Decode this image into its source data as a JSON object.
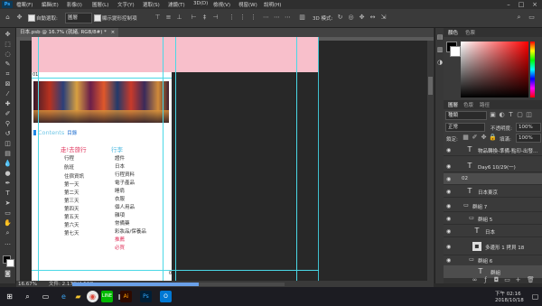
{
  "menubar": {
    "logo": "Ps",
    "items": [
      "檔案(F)",
      "編輯(E)",
      "影像(I)",
      "圖層(L)",
      "文字(Y)",
      "選取(S)",
      "濾鏡(T)",
      "3D(D)",
      "檢視(V)",
      "視窗(W)",
      "說明(H)"
    ]
  },
  "options": {
    "auto_select_label": "自動選取:",
    "auto_select_value": "圖層",
    "show_transform_label": "顯示變形控制項",
    "mode_3d_label": "3D 模式:"
  },
  "tab": {
    "title": "日本.psb @ 16.7% (就緒, RGB/8#) *",
    "close": "×"
  },
  "document": {
    "page_mark_top": "01",
    "page_mark_bottom": "02",
    "contents_title": "Contents",
    "contents_sub": "目錄",
    "left_heading": "走!去旅行",
    "left_items": [
      "行程",
      "航班",
      "住宿資訊",
      "第一天",
      "第二天",
      "第三天",
      "第四天",
      "第五天",
      "第六天",
      "第七天"
    ],
    "right_heading": "行李",
    "right_items": [
      "證件",
      "日本",
      "行程資料",
      "電子產品",
      "睡肩",
      "衣服",
      "個人用品",
      "雜項",
      "常備藥",
      "彩妝品/保養品"
    ],
    "right_highlight_1": "推薦",
    "right_highlight_2": "必買"
  },
  "status": {
    "zoom": "16.67%",
    "doc_info": "文件: 2.17G/4.53G"
  },
  "panels": {
    "color_tab": "顏色",
    "swatch_tab": "色票",
    "layers_tab": "圖層",
    "channels_tab": "色版",
    "paths_tab": "路徑",
    "filter_kind": "種類",
    "blend_mode": "正常",
    "opacity_label": "不透明度:",
    "opacity_value": "100%",
    "lock_label": "鎖定:",
    "fill_label": "填滿:",
    "fill_value": "100%"
  },
  "layers": [
    {
      "name": "物品轉換-準備-點印-出發...",
      "type": "text"
    },
    {
      "name": "Day6 10/29(一)",
      "type": "text"
    },
    {
      "name": "02",
      "type": "group"
    },
    {
      "name": "日本東京",
      "type": "text"
    },
    {
      "name": "群組 7",
      "type": "group"
    },
    {
      "name": "群組 5",
      "type": "group"
    },
    {
      "name": "日本",
      "type": "text"
    },
    {
      "name": "多邊形 1 拷貝 18",
      "type": "shape"
    },
    {
      "name": "群組 6",
      "type": "group"
    },
    {
      "name": "群組",
      "type": "text"
    }
  ],
  "taskbar": {
    "time": "下午 02:16",
    "date": "2018/10/18",
    "ai_label": "Ai",
    "ps_label": "Ps",
    "ol_label": "O"
  },
  "colors": {
    "accent_blue": "#1e88e5",
    "pink": "#f8bfcb",
    "cyan_guide": "#4ad8e6",
    "red_heading": "#e0315a"
  }
}
